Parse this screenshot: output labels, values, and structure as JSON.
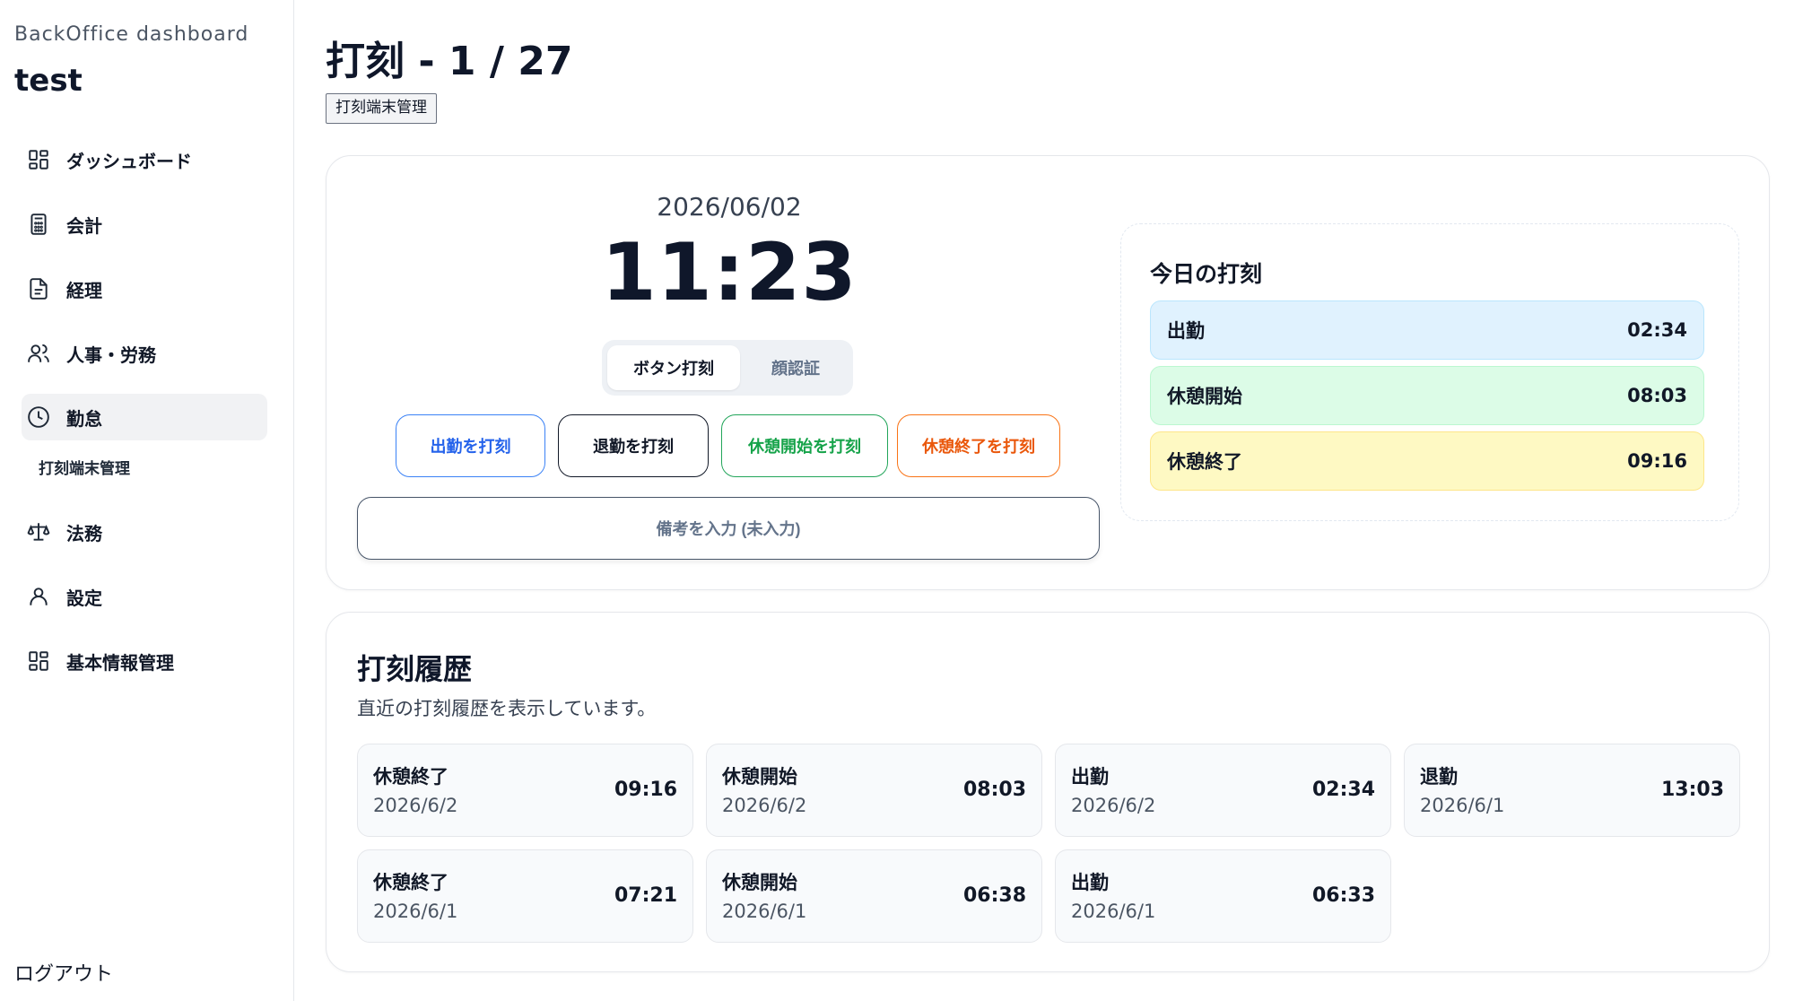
{
  "sidebar": {
    "brand_subtitle": "BackOffice dashboard",
    "brand_title": "test",
    "items": [
      {
        "label": "ダッシュボード",
        "icon": "dashboard-grid-icon"
      },
      {
        "label": "会計",
        "icon": "calculator-icon"
      },
      {
        "label": "経理",
        "icon": "document-icon"
      },
      {
        "label": "人事・労務",
        "icon": "users-icon"
      },
      {
        "label": "勤怠",
        "icon": "clock-icon",
        "active": true
      },
      {
        "label": "法務",
        "icon": "scale-icon"
      },
      {
        "label": "設定",
        "icon": "user-icon"
      },
      {
        "label": "基本情報管理",
        "icon": "grid-icon"
      }
    ],
    "sub_item": "打刻端末管理",
    "logout": "ログアウト"
  },
  "header": {
    "title": "打刻 - 1 / 27",
    "tag": "打刻端末管理"
  },
  "clock": {
    "date": "2026/06/02",
    "time": "11:23"
  },
  "mode_tabs": {
    "selected": "ボタン打刻",
    "other": "顔認証"
  },
  "actions": {
    "clock_in": "出勤を打刻",
    "clock_out": "退勤を打刻",
    "break_start": "休憩開始を打刻",
    "break_end": "休憩終了を打刻"
  },
  "memo": {
    "label": "備考を入力 (未入力)"
  },
  "today": {
    "title": "今日の打刻",
    "rows": [
      {
        "label": "出勤",
        "time": "02:34",
        "bg": "#e0f2fe",
        "border": "#bae6fd"
      },
      {
        "label": "休憩開始",
        "time": "08:03",
        "bg": "#dcfce7",
        "border": "#bbf7d0"
      },
      {
        "label": "休憩終了",
        "time": "09:16",
        "bg": "#fef9c3",
        "border": "#fde68a"
      }
    ]
  },
  "history": {
    "title": "打刻履歴",
    "description": "直近の打刻履歴を表示しています。",
    "items": [
      {
        "type": "休憩終了",
        "date": "2026/6/2",
        "time": "09:16"
      },
      {
        "type": "休憩開始",
        "date": "2026/6/2",
        "time": "08:03"
      },
      {
        "type": "出勤",
        "date": "2026/6/2",
        "time": "02:34"
      },
      {
        "type": "退勤",
        "date": "2026/6/1",
        "time": "13:03"
      },
      {
        "type": "休憩終了",
        "date": "2026/6/1",
        "time": "07:21"
      },
      {
        "type": "休憩開始",
        "date": "2026/6/1",
        "time": "06:38"
      },
      {
        "type": "出勤",
        "date": "2026/6/1",
        "time": "06:33"
      }
    ]
  },
  "colors": {
    "accent_blue": "#2563eb",
    "accent_green": "#16a34a",
    "accent_orange": "#ea580c",
    "text_dark": "#0f172a"
  }
}
